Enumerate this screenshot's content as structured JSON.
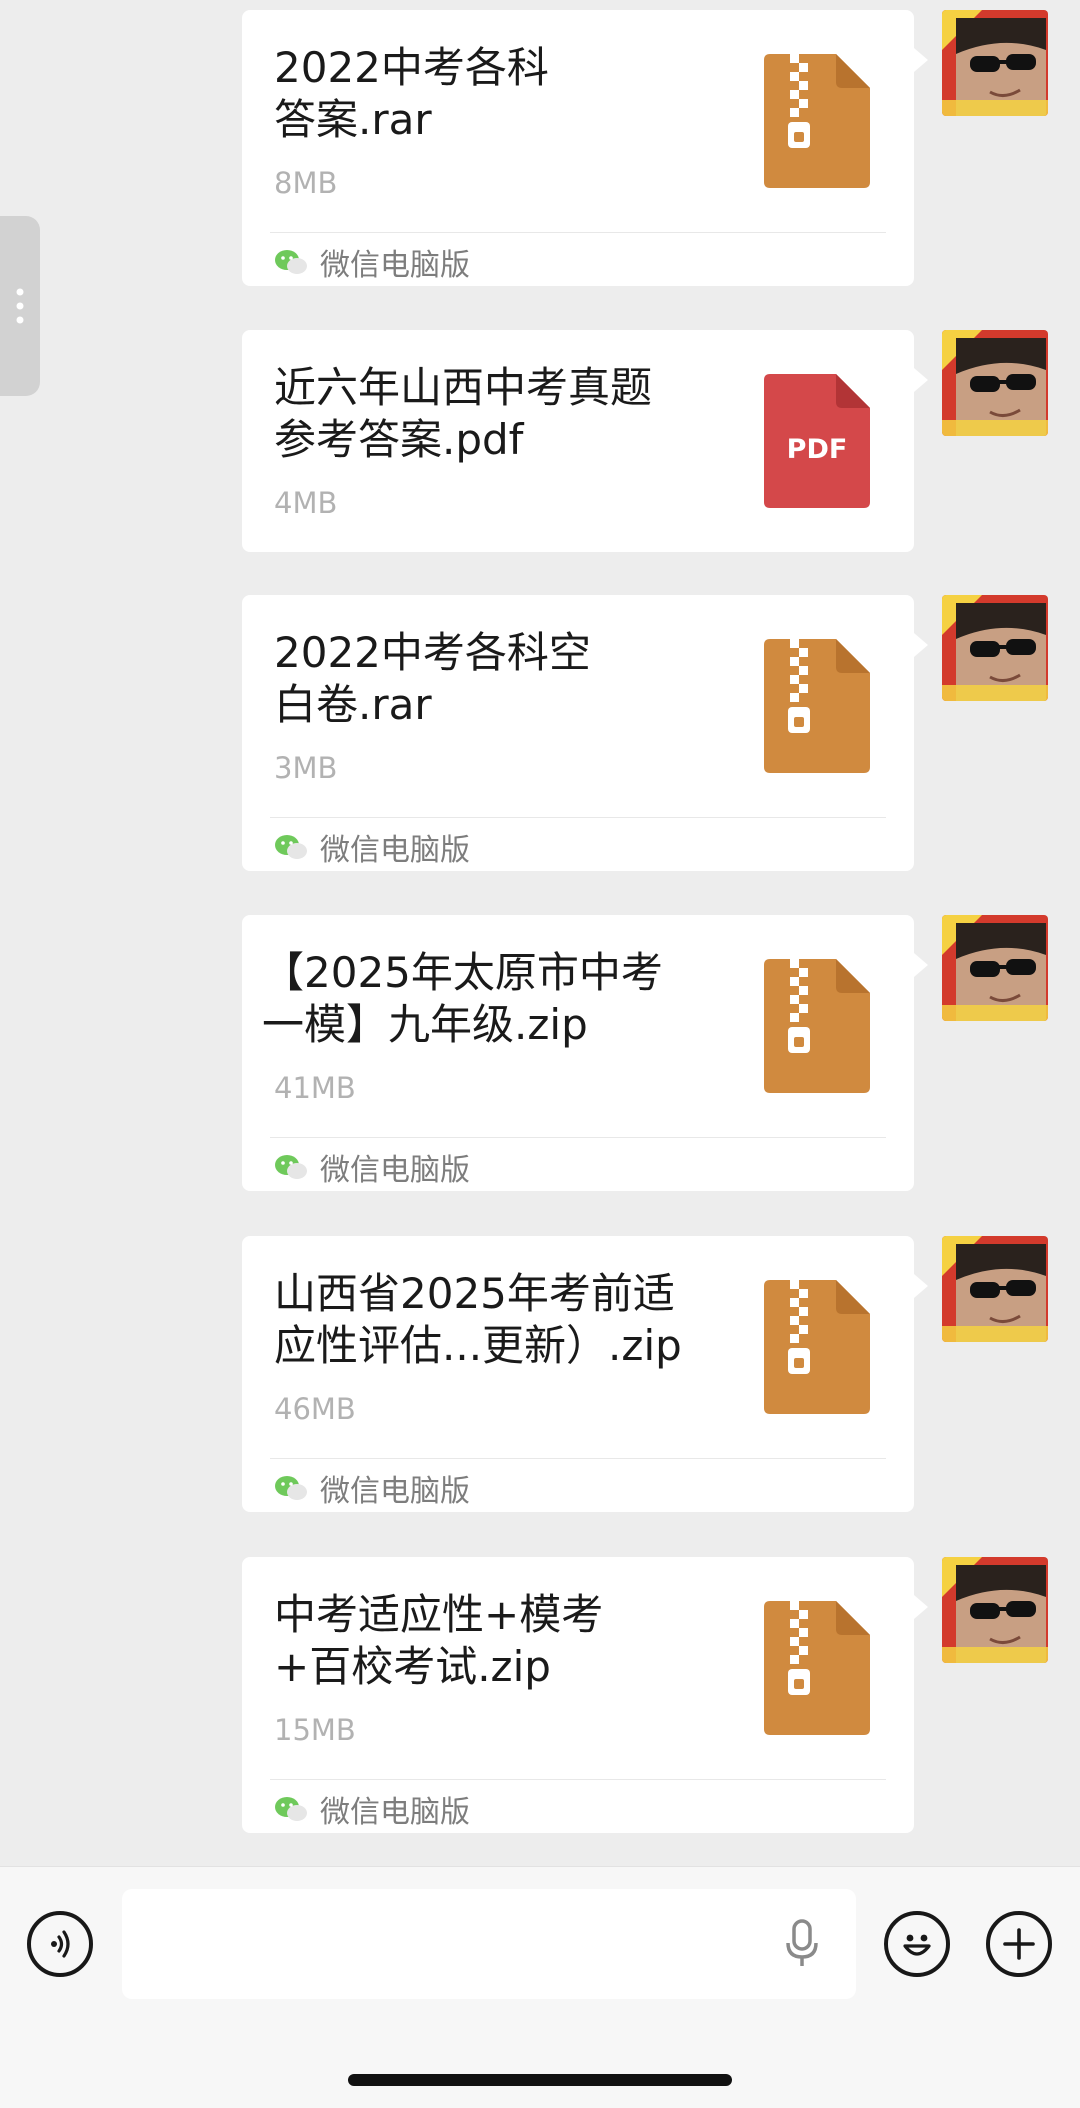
{
  "messages": [
    {
      "name": "2022中考各科\n答案.rar",
      "size": "8MB",
      "type": "zip",
      "source": "微信电脑版"
    },
    {
      "name": "近六年山西中考真题\n参考答案.pdf",
      "size": "4MB",
      "type": "pdf",
      "pdf_label": "PDF",
      "source": ""
    },
    {
      "name": "2022中考各科空\n白卷.rar",
      "size": "3MB",
      "type": "zip",
      "source": "微信电脑版"
    },
    {
      "name": "【2025年太原市中考\n一模】九年级.zip",
      "size": "41MB",
      "type": "zip",
      "source": "微信电脑版"
    },
    {
      "name": "山西省2025年考前适\n应性评估...更新）.zip",
      "size": "46MB",
      "type": "zip",
      "source": "微信电脑版"
    },
    {
      "name": "中考适应性+模考\n+百校考试.zip",
      "size": "15MB",
      "type": "zip",
      "source": "微信电脑版"
    }
  ],
  "input_bar": {
    "placeholder": "",
    "voice_icon": "voice-icon",
    "mic_icon": "microphone-icon",
    "emoji_icon": "emoji-icon",
    "plus_icon": "plus-icon"
  },
  "colors": {
    "zip_icon": "#d08a3f",
    "pdf_icon": "#d4484a",
    "background": "#ededed",
    "bubble": "#ffffff"
  }
}
